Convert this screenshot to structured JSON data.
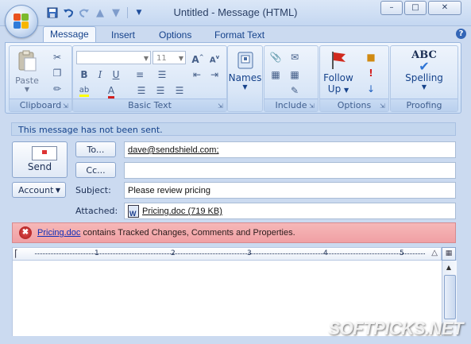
{
  "window": {
    "title": "Untitled - Message (HTML)",
    "controls": {
      "minimize": "–",
      "maximize": "□",
      "close": "✕"
    }
  },
  "qat": {
    "items": [
      "save-icon",
      "undo-icon",
      "redo-icon",
      "arrow-up-icon",
      "arrow-down-icon",
      "customize-icon"
    ]
  },
  "tabs": [
    {
      "label": "Message",
      "active": true
    },
    {
      "label": "Insert",
      "active": false
    },
    {
      "label": "Options",
      "active": false
    },
    {
      "label": "Format Text",
      "active": false
    }
  ],
  "ribbon": {
    "clipboard": {
      "label": "Clipboard",
      "paste": "Paste"
    },
    "basic_text": {
      "label": "Basic Text",
      "font": "",
      "size": "11",
      "bold": "B",
      "italic": "I",
      "underline": "U"
    },
    "names": {
      "label": "Names"
    },
    "include": {
      "label": "Include"
    },
    "options": {
      "label": "Options",
      "follow_up": "Follow",
      "follow_up2": "Up"
    },
    "proofing": {
      "label": "Proofing",
      "spelling": "Spelling",
      "abc": "ABC"
    }
  },
  "infobar": {
    "text": "This message has not been sent."
  },
  "form": {
    "send": "Send",
    "to_btn": "To...",
    "cc_btn": "Cc...",
    "account_btn": "Account",
    "to_value": "dave@sendshield.com;",
    "cc_value": "",
    "subject_label": "Subject:",
    "subject_value": "Please review pricing",
    "attached_label": "Attached:",
    "attached_value": "Pricing.doc (719 KB)"
  },
  "warning": {
    "link": "Pricing.doc",
    "text": " contains Tracked Changes, Comments and Properties."
  },
  "ruler": {
    "numbers": [
      "1",
      "2",
      "3",
      "4",
      "5"
    ]
  },
  "watermark": "SOFTPICKS.NET"
}
